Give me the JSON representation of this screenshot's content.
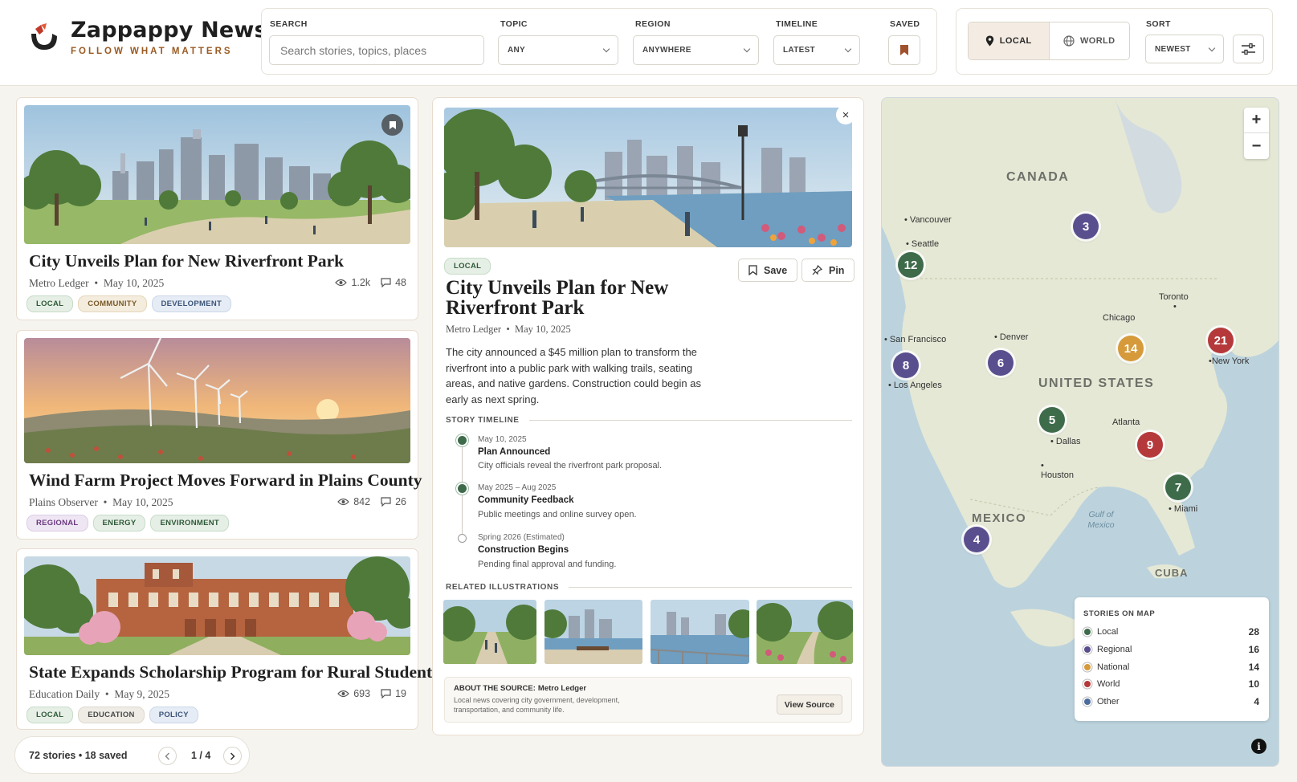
{
  "brand": {
    "name": "Zappappy News",
    "tagline": "FOLLOW WHAT MATTERS"
  },
  "filters": {
    "search": {
      "label": "SEARCH",
      "placeholder": "Search stories, topics, places",
      "value": ""
    },
    "topic": {
      "label": "TOPIC",
      "value": "ANY"
    },
    "region": {
      "label": "REGION",
      "value": "ANYWHERE"
    },
    "timeline": {
      "label": "TIMELINE",
      "value": "LATEST"
    },
    "saved": {
      "label": "SAVED",
      "icon": "bookmark-icon"
    }
  },
  "scope": {
    "local_label": "LOCAL",
    "world_label": "WORLD",
    "active": "LOCAL",
    "sort_label": "SORT",
    "sort_value": "NEWEST"
  },
  "stories": [
    {
      "title": "City Unveils Plan for New Riverfront Park",
      "source": "Metro Ledger",
      "date": "May 10, 2025",
      "views": "1.2k",
      "comments": "48",
      "tags": [
        "LOCAL",
        "COMMUNITY",
        "DEVELOPMENT"
      ]
    },
    {
      "title": "Wind Farm Project Moves Forward in Plains County",
      "source": "Plains Observer",
      "date": "May 10, 2025",
      "views": "842",
      "comments": "26",
      "tags": [
        "REGIONAL",
        "ENERGY",
        "ENVIRONMENT"
      ]
    },
    {
      "title": "State Expands Scholarship Program for Rural Students",
      "source": "Education Daily",
      "date": "May 9, 2025",
      "views": "693",
      "comments": "19",
      "tags": [
        "LOCAL",
        "EDUCATION",
        "POLICY"
      ]
    }
  ],
  "pager": {
    "summary": "72 stories  •  18 saved",
    "page": "1 / 4"
  },
  "detail": {
    "tag": "LOCAL",
    "save_label": "Save",
    "pin_label": "Pin",
    "title": "City Unveils Plan for New Riverfront Park",
    "source": "Metro Ledger",
    "date": "May 10, 2025",
    "body": "The city announced a $45 million plan to transform the riverfront into a public park with walking trails, seating areas, and native gardens. Construction could begin as early as next spring.",
    "timeline_heading": "STORY TIMELINE",
    "timeline": [
      {
        "date": "May 10, 2025",
        "title": "Plan Announced",
        "desc": "City officials reveal the riverfront park proposal.",
        "done": true
      },
      {
        "date": "May 2025 – Aug 2025",
        "title": "Community Feedback",
        "desc": "Public meetings and online survey open.",
        "done": true
      },
      {
        "date": "Spring 2026 (Estimated)",
        "title": "Construction Begins",
        "desc": "Pending final approval and funding.",
        "done": false
      }
    ],
    "related_heading": "RELATED ILLUSTRATIONS",
    "about_label": "ABOUT THE SOURCE:",
    "about_name": "Metro Ledger",
    "about_desc": "Local news covering city government, development, transportation, and community life.",
    "view_source_label": "View Source"
  },
  "map": {
    "labels": {
      "canada": "CANADA",
      "us": "UNITED STATES",
      "mexico": "MEXICO",
      "cuba": "CUBA",
      "gulf": "Gulf of Mexico",
      "vancouver": "Vancouver",
      "seattle": "Seattle",
      "sf": "San Francisco",
      "la": "Los Angeles",
      "denver": "Denver",
      "chicago": "Chicago",
      "toronto": "Toronto",
      "ny": "New York",
      "dallas": "Dallas",
      "houston": "Houston",
      "atlanta": "Atlanta",
      "miami": "Miami"
    },
    "clusters": [
      {
        "count": "3",
        "category": "Regional"
      },
      {
        "count": "12",
        "category": "Local"
      },
      {
        "count": "8",
        "category": "Regional"
      },
      {
        "count": "6",
        "category": "Regional"
      },
      {
        "count": "14",
        "category": "National"
      },
      {
        "count": "21",
        "category": "World"
      },
      {
        "count": "5",
        "category": "Local"
      },
      {
        "count": "9",
        "category": "World"
      },
      {
        "count": "7",
        "category": "Local"
      },
      {
        "count": "4",
        "category": "Regional"
      }
    ],
    "legend": {
      "heading": "STORIES ON MAP",
      "items": [
        {
          "label": "Local",
          "count": "28",
          "color": "#3e6b4a"
        },
        {
          "label": "Regional",
          "count": "16",
          "color": "#5a4f8e"
        },
        {
          "label": "National",
          "count": "14",
          "color": "#d69a3a"
        },
        {
          "label": "World",
          "count": "10",
          "color": "#b5393a"
        },
        {
          "label": "Other",
          "count": "4",
          "color": "#4a6d9e"
        }
      ]
    }
  },
  "colors": {
    "accent": "#9a5a22",
    "brand_dark": "#1f1f1f",
    "bookmark": "#a0522d",
    "map_water": "#bcd3dd",
    "map_land": "#e5e8d5"
  }
}
